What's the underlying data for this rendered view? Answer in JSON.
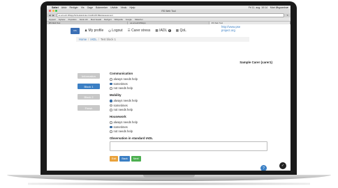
{
  "menubar": {
    "app": "Safari",
    "items": [
      "Arkiv",
      "Redigér",
      "Vis",
      "Gage",
      "Bokmerker",
      "Utvikle",
      "Vindu",
      "Hjelp"
    ],
    "clock": "Fri 11. aug. 10:14",
    "user": "Mari Økgaardsæ"
  },
  "window": {
    "title": "RS Web Tool"
  },
  "toolbar": {
    "url": "ac-art.esh.RSApp/Schedule/index.html#/ANT-BEA/assessment"
  },
  "bookmarks": [
    "Oppsett",
    "Nyheter",
    "Populære",
    "Norsk HC",
    "Mest besøkt",
    "Redigert",
    "Wikipedia",
    "Google",
    "Sikkerhet"
  ],
  "tabs": [
    "RS Web Tool",
    "ac-art.esh.RSApp",
    "RS Web Tool"
  ],
  "nav": {
    "logo": "RS",
    "items": [
      {
        "icon": "user-icon",
        "glyph": "♟",
        "label": "My profile"
      },
      {
        "icon": "logout-icon",
        "glyph": "⏻",
        "label": "Logout"
      },
      {
        "icon": "list-icon",
        "glyph": "☰",
        "label": "Carer stress"
      },
      {
        "icon": "grid-icon",
        "glyph": "▦",
        "label": "IADL",
        "badge": "6"
      },
      {
        "icon": "grid-icon",
        "glyph": "▦",
        "label": "QoL"
      }
    ],
    "side_link": "http://www.pse project.org"
  },
  "breadcrumb": {
    "home": "Home",
    "section": "IADL",
    "current": "Test block 1"
  },
  "care_label": "Sample Carer (carer1)",
  "sidebar": [
    {
      "label": "Information",
      "color": "#c8c8c8"
    },
    {
      "label": "Block 1",
      "color": "#3b7fc4"
    },
    {
      "label": "Block 2",
      "color": "#c8c8c8"
    },
    {
      "label": "Finish",
      "color": "#c8c8c8"
    }
  ],
  "sections": [
    {
      "title": "Communication",
      "options": [
        "always needs help",
        "sometimes",
        "not needs help"
      ],
      "selected": 1
    },
    {
      "title": "Mobility",
      "options": [
        "always needs help",
        "sometimes",
        "not needs help"
      ],
      "selected": 0
    },
    {
      "title": "Housework",
      "options": [
        "always needs help",
        "sometimes",
        "not needs help"
      ],
      "selected": 1
    }
  ],
  "observation_label": "Observation in standard IADL",
  "buttons": [
    {
      "label": "Exit",
      "color": "#e9a23b"
    },
    {
      "label": "Back",
      "color": "#3b7fc4"
    },
    {
      "label": "Next",
      "color": "#4caf50"
    }
  ],
  "help_glyph": "?",
  "corner_glyph": "✓",
  "colors": {
    "accent": "#3b7fc4",
    "bezel": "#1a1a1a"
  }
}
